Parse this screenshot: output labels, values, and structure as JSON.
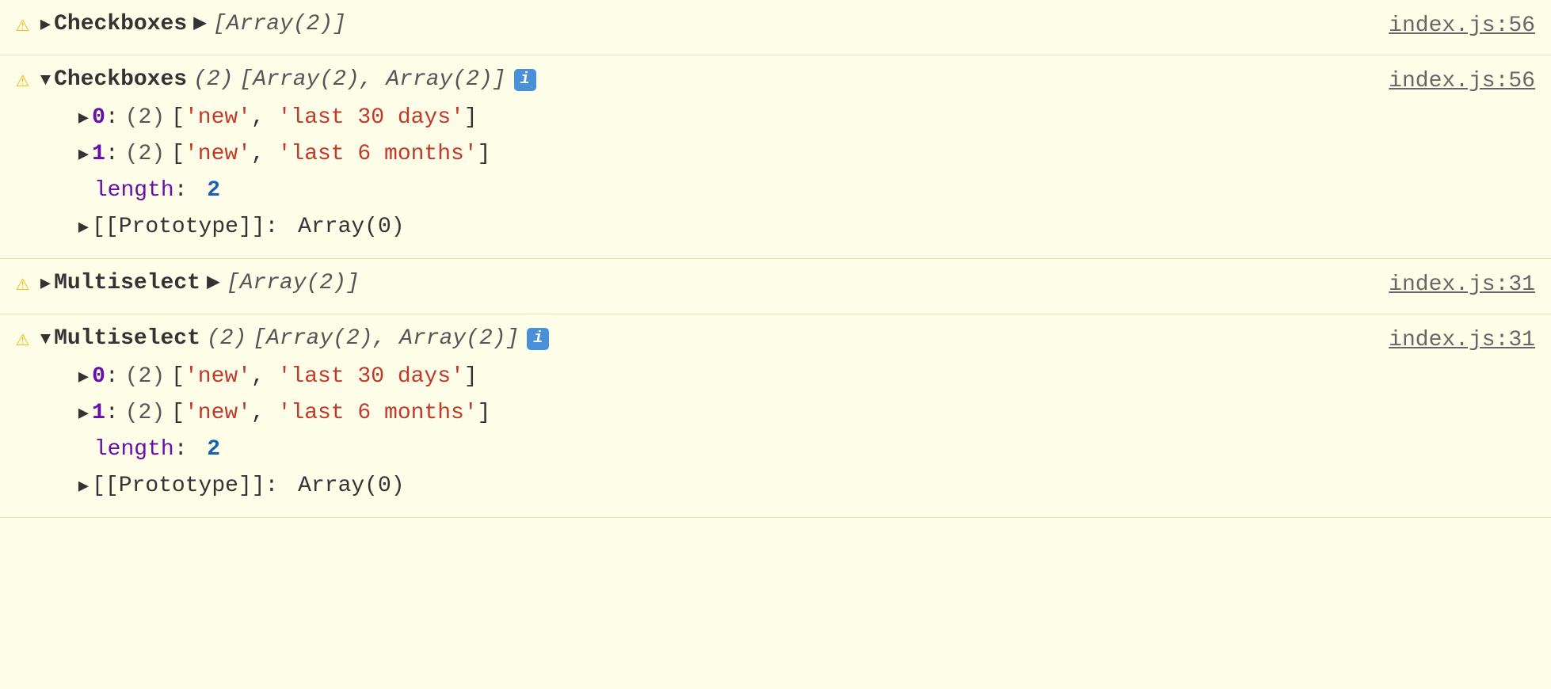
{
  "rows": [
    {
      "id": "row1",
      "warning": true,
      "expanded": false,
      "label": "Checkboxes",
      "arrow_direction": "right",
      "preview": "[Array(2)]",
      "file": "index.js:56",
      "show_info": false
    },
    {
      "id": "row2",
      "warning": true,
      "expanded": true,
      "label": "Checkboxes",
      "arrow_direction": "down",
      "count": "(2)",
      "preview": "[Array(2), Array(2)]",
      "file": "index.js:56",
      "show_info": true,
      "items": [
        {
          "index": "0",
          "size": "(2)",
          "values": [
            "'new'",
            "'last 30 days'"
          ]
        },
        {
          "index": "1",
          "size": "(2)",
          "values": [
            "'new'",
            "'last 6 months'"
          ]
        }
      ],
      "length_label": "length",
      "length_value": "2",
      "prototype_label": "[[Prototype]]",
      "prototype_value": "Array(0)"
    },
    {
      "id": "row3",
      "warning": true,
      "expanded": false,
      "label": "Multiselect",
      "arrow_direction": "right",
      "preview": "[Array(2)]",
      "file": "index.js:31",
      "show_info": false
    },
    {
      "id": "row4",
      "warning": true,
      "expanded": true,
      "label": "Multiselect",
      "arrow_direction": "down",
      "count": "(2)",
      "preview": "[Array(2), Array(2)]",
      "file": "index.js:31",
      "show_info": true,
      "items": [
        {
          "index": "0",
          "size": "(2)",
          "values": [
            "'new'",
            "'last 30 days'"
          ]
        },
        {
          "index": "1",
          "size": "(2)",
          "values": [
            "'new'",
            "'last 6 months'"
          ]
        }
      ],
      "length_label": "length",
      "length_value": "2",
      "prototype_label": "[[Prototype]]",
      "prototype_value": "Array(0)"
    }
  ],
  "icons": {
    "warning": "⚠",
    "arrow_right": "▶",
    "arrow_down": "▼",
    "sub_arrow": "▶",
    "info_label": "i"
  }
}
